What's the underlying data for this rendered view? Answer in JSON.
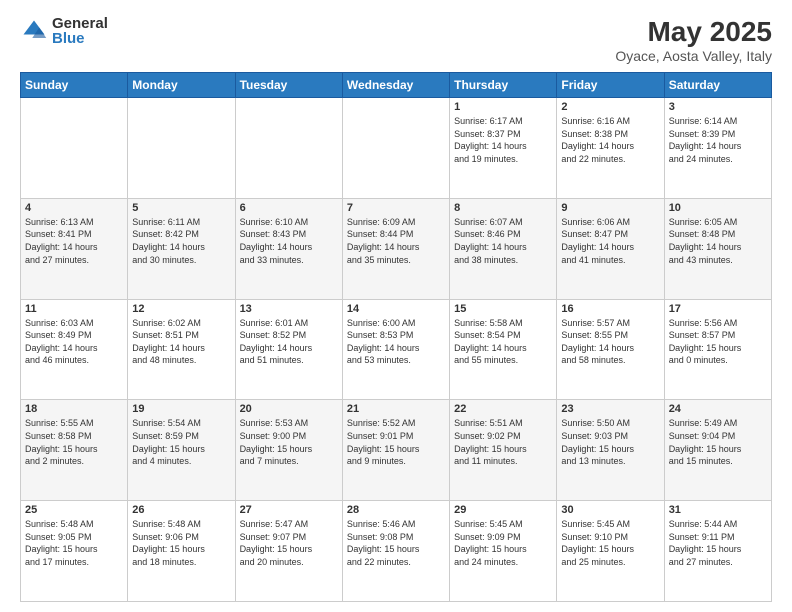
{
  "header": {
    "logo_general": "General",
    "logo_blue": "Blue",
    "title": "May 2025",
    "subtitle": "Oyace, Aosta Valley, Italy"
  },
  "days_of_week": [
    "Sunday",
    "Monday",
    "Tuesday",
    "Wednesday",
    "Thursday",
    "Friday",
    "Saturday"
  ],
  "weeks": [
    [
      {
        "day": "",
        "info": ""
      },
      {
        "day": "",
        "info": ""
      },
      {
        "day": "",
        "info": ""
      },
      {
        "day": "",
        "info": ""
      },
      {
        "day": "1",
        "info": "Sunrise: 6:17 AM\nSunset: 8:37 PM\nDaylight: 14 hours\nand 19 minutes."
      },
      {
        "day": "2",
        "info": "Sunrise: 6:16 AM\nSunset: 8:38 PM\nDaylight: 14 hours\nand 22 minutes."
      },
      {
        "day": "3",
        "info": "Sunrise: 6:14 AM\nSunset: 8:39 PM\nDaylight: 14 hours\nand 24 minutes."
      }
    ],
    [
      {
        "day": "4",
        "info": "Sunrise: 6:13 AM\nSunset: 8:41 PM\nDaylight: 14 hours\nand 27 minutes."
      },
      {
        "day": "5",
        "info": "Sunrise: 6:11 AM\nSunset: 8:42 PM\nDaylight: 14 hours\nand 30 minutes."
      },
      {
        "day": "6",
        "info": "Sunrise: 6:10 AM\nSunset: 8:43 PM\nDaylight: 14 hours\nand 33 minutes."
      },
      {
        "day": "7",
        "info": "Sunrise: 6:09 AM\nSunset: 8:44 PM\nDaylight: 14 hours\nand 35 minutes."
      },
      {
        "day": "8",
        "info": "Sunrise: 6:07 AM\nSunset: 8:46 PM\nDaylight: 14 hours\nand 38 minutes."
      },
      {
        "day": "9",
        "info": "Sunrise: 6:06 AM\nSunset: 8:47 PM\nDaylight: 14 hours\nand 41 minutes."
      },
      {
        "day": "10",
        "info": "Sunrise: 6:05 AM\nSunset: 8:48 PM\nDaylight: 14 hours\nand 43 minutes."
      }
    ],
    [
      {
        "day": "11",
        "info": "Sunrise: 6:03 AM\nSunset: 8:49 PM\nDaylight: 14 hours\nand 46 minutes."
      },
      {
        "day": "12",
        "info": "Sunrise: 6:02 AM\nSunset: 8:51 PM\nDaylight: 14 hours\nand 48 minutes."
      },
      {
        "day": "13",
        "info": "Sunrise: 6:01 AM\nSunset: 8:52 PM\nDaylight: 14 hours\nand 51 minutes."
      },
      {
        "day": "14",
        "info": "Sunrise: 6:00 AM\nSunset: 8:53 PM\nDaylight: 14 hours\nand 53 minutes."
      },
      {
        "day": "15",
        "info": "Sunrise: 5:58 AM\nSunset: 8:54 PM\nDaylight: 14 hours\nand 55 minutes."
      },
      {
        "day": "16",
        "info": "Sunrise: 5:57 AM\nSunset: 8:55 PM\nDaylight: 14 hours\nand 58 minutes."
      },
      {
        "day": "17",
        "info": "Sunrise: 5:56 AM\nSunset: 8:57 PM\nDaylight: 15 hours\nand 0 minutes."
      }
    ],
    [
      {
        "day": "18",
        "info": "Sunrise: 5:55 AM\nSunset: 8:58 PM\nDaylight: 15 hours\nand 2 minutes."
      },
      {
        "day": "19",
        "info": "Sunrise: 5:54 AM\nSunset: 8:59 PM\nDaylight: 15 hours\nand 4 minutes."
      },
      {
        "day": "20",
        "info": "Sunrise: 5:53 AM\nSunset: 9:00 PM\nDaylight: 15 hours\nand 7 minutes."
      },
      {
        "day": "21",
        "info": "Sunrise: 5:52 AM\nSunset: 9:01 PM\nDaylight: 15 hours\nand 9 minutes."
      },
      {
        "day": "22",
        "info": "Sunrise: 5:51 AM\nSunset: 9:02 PM\nDaylight: 15 hours\nand 11 minutes."
      },
      {
        "day": "23",
        "info": "Sunrise: 5:50 AM\nSunset: 9:03 PM\nDaylight: 15 hours\nand 13 minutes."
      },
      {
        "day": "24",
        "info": "Sunrise: 5:49 AM\nSunset: 9:04 PM\nDaylight: 15 hours\nand 15 minutes."
      }
    ],
    [
      {
        "day": "25",
        "info": "Sunrise: 5:48 AM\nSunset: 9:05 PM\nDaylight: 15 hours\nand 17 minutes."
      },
      {
        "day": "26",
        "info": "Sunrise: 5:48 AM\nSunset: 9:06 PM\nDaylight: 15 hours\nand 18 minutes."
      },
      {
        "day": "27",
        "info": "Sunrise: 5:47 AM\nSunset: 9:07 PM\nDaylight: 15 hours\nand 20 minutes."
      },
      {
        "day": "28",
        "info": "Sunrise: 5:46 AM\nSunset: 9:08 PM\nDaylight: 15 hours\nand 22 minutes."
      },
      {
        "day": "29",
        "info": "Sunrise: 5:45 AM\nSunset: 9:09 PM\nDaylight: 15 hours\nand 24 minutes."
      },
      {
        "day": "30",
        "info": "Sunrise: 5:45 AM\nSunset: 9:10 PM\nDaylight: 15 hours\nand 25 minutes."
      },
      {
        "day": "31",
        "info": "Sunrise: 5:44 AM\nSunset: 9:11 PM\nDaylight: 15 hours\nand 27 minutes."
      }
    ]
  ]
}
